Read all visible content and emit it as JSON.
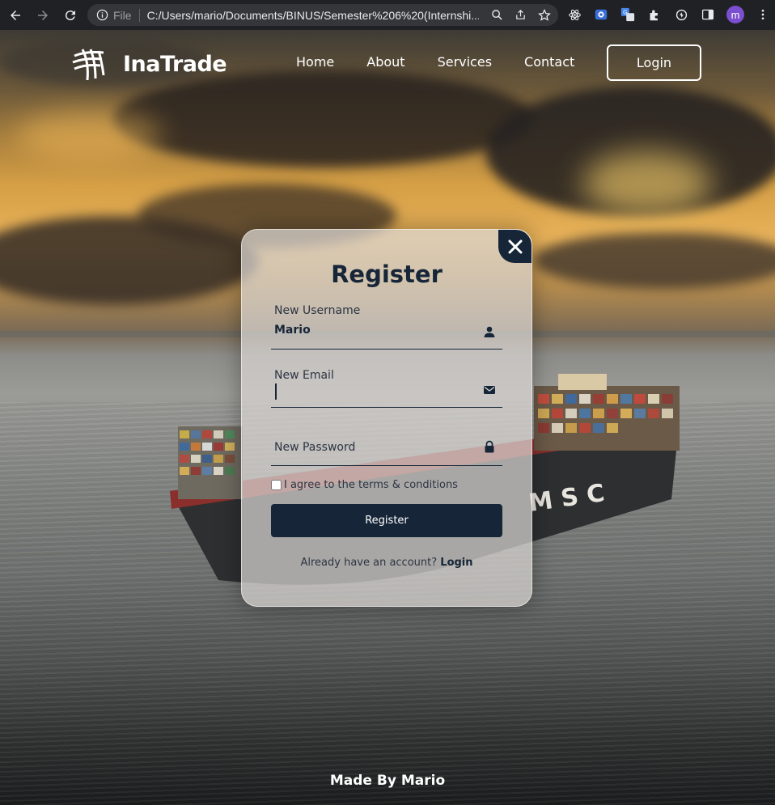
{
  "browser": {
    "scheme_label": "File",
    "url": "C:/Users/mario/Documents/BINUS/Semester%206%20(Internshi...",
    "profile_initial": "m"
  },
  "site": {
    "brand": "InaTrade",
    "nav": [
      "Home",
      "About",
      "Services",
      "Contact"
    ],
    "login_button": "Login"
  },
  "register_modal": {
    "title": "Register",
    "username_label": "New Username",
    "username_value": "Mario",
    "email_label": "New Email",
    "email_value": "",
    "password_label": "New Password",
    "terms_text": "I agree to the terms & conditions",
    "terms_checked": false,
    "submit_label": "Register",
    "login_prompt": "Already have an account?",
    "login_link": "Login"
  },
  "footer": "Made By Mario",
  "colors": {
    "navy": "#162638",
    "white": "#ffffff",
    "chrome_bg": "#202124",
    "avatar": "#7b4fd0"
  },
  "icons": {
    "username": "person-icon",
    "email": "envelope-icon",
    "password": "lock-icon",
    "close": "close-icon"
  }
}
